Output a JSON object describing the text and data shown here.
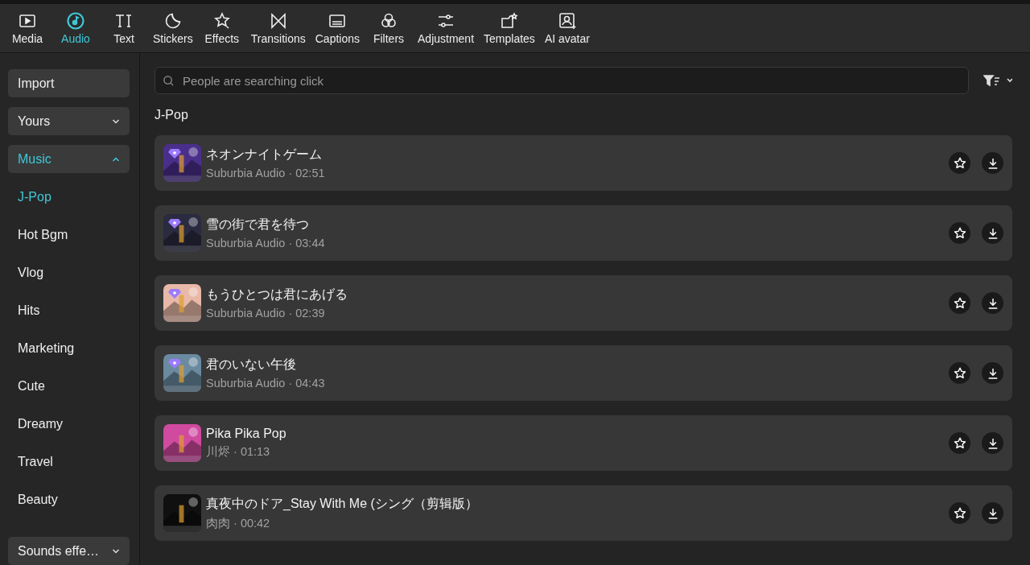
{
  "toolbar": {
    "tabs": [
      {
        "label": "Media",
        "selected": false
      },
      {
        "label": "Audio",
        "selected": true
      },
      {
        "label": "Text",
        "selected": false
      },
      {
        "label": "Stickers",
        "selected": false
      },
      {
        "label": "Effects",
        "selected": false
      },
      {
        "label": "Transitions",
        "selected": false
      },
      {
        "label": "Captions",
        "selected": false
      },
      {
        "label": "Filters",
        "selected": false
      },
      {
        "label": "Adjustment",
        "selected": false
      },
      {
        "label": "Templates",
        "selected": false
      },
      {
        "label": "AI avatar",
        "selected": false
      }
    ]
  },
  "sidebar": {
    "items": [
      {
        "label": "Import",
        "kind": "button"
      },
      {
        "label": "Yours",
        "kind": "group",
        "expanded": false,
        "selected": false
      },
      {
        "label": "Music",
        "kind": "group",
        "expanded": true,
        "selected": true,
        "children": [
          {
            "label": "J-Pop",
            "selected": true
          },
          {
            "label": "Hot Bgm",
            "selected": false
          },
          {
            "label": "Vlog",
            "selected": false
          },
          {
            "label": "Hits",
            "selected": false
          },
          {
            "label": "Marketing",
            "selected": false
          },
          {
            "label": "Cute",
            "selected": false
          },
          {
            "label": "Dreamy",
            "selected": false
          },
          {
            "label": "Travel",
            "selected": false
          },
          {
            "label": "Beauty",
            "selected": false
          }
        ]
      }
    ],
    "footer": {
      "label": "Sounds effe…",
      "expanded": false
    }
  },
  "search": {
    "placeholder": "People are searching click"
  },
  "section_title": "J-Pop",
  "tracks": [
    {
      "title": "ネオンナイトゲーム",
      "meta": "Suburbia Audio · 02:51",
      "premium": true
    },
    {
      "title": "雪の街で君を待つ",
      "meta": "Suburbia Audio · 03:44",
      "premium": true
    },
    {
      "title": "もうひとつは君にあげる",
      "meta": "Suburbia Audio · 02:39",
      "premium": true
    },
    {
      "title": "君のいない午後",
      "meta": "Suburbia Audio · 04:43",
      "premium": true
    },
    {
      "title": "Pika Pika Pop",
      "meta": "川烬 · 01:13",
      "premium": false
    },
    {
      "title": "真夜中のドア_Stay With Me (シング（剪辑版）",
      "meta": "肉肉 · 00:42",
      "premium": false
    }
  ]
}
